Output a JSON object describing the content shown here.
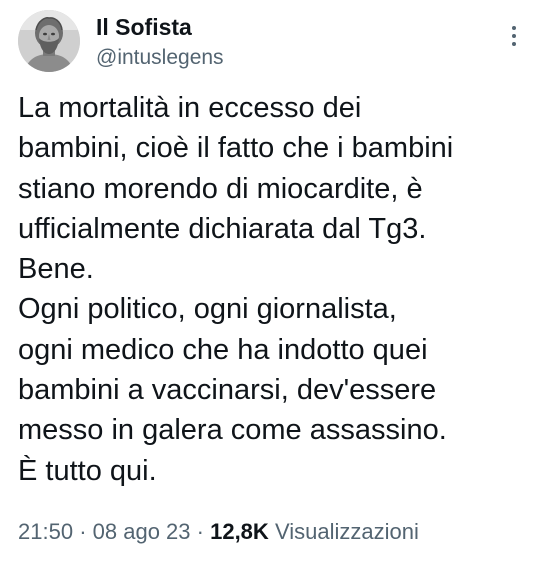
{
  "author": {
    "display_name": "Il Sofista",
    "handle": "@intuslegens",
    "avatar_icon": "bust-statue-avatar"
  },
  "menu": {
    "icon": "more-vertical-icon"
  },
  "tweet": {
    "text": "La mortalità in eccesso dei\nbambini, cioè il fatto che i bambini\nstiano morendo di miocardite, è\nufficialmente dichiarata dal Tg3.\nBene.\nOgni politico, ogni giornalista,\nogni medico che ha indotto quei\nbambini a vaccinarsi, dev'essere\nmesso in galera come assassino.\nÈ tutto qui."
  },
  "meta": {
    "time": "21:50",
    "separator": "·",
    "date": "08 ago 23",
    "views_count": "12,8K",
    "views_label": "Visualizzazioni"
  },
  "colors": {
    "text_primary": "#0f1419",
    "text_secondary": "#536471",
    "background": "#ffffff"
  }
}
